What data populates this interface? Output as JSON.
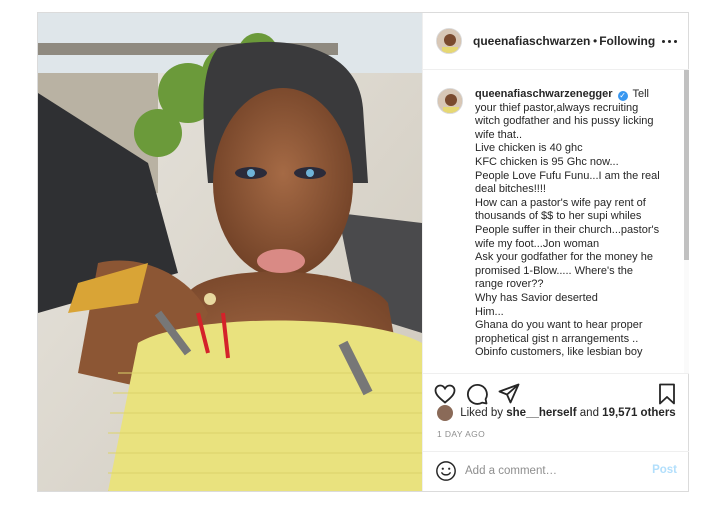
{
  "post": {
    "username": "queenafiaschwarzenegger",
    "username_header": "queenafiaschwarzeneg",
    "follow_status": "Following",
    "caption_lines": [
      "Tell",
      "your thief pastor,always recruiting",
      "witch godfather and his pussy licking",
      "wife that..",
      "Live chicken is 40 ghc",
      "KFC chicken is 95 Ghc now...",
      "People Love Fufu Funu...I am the real",
      "deal bitches!!!!",
      "How can a pastor's wife pay rent of",
      "thousands of $$ to her supi whiles",
      "People suffer in their church...pastor's",
      "wife my foot...Jon woman",
      "Ask your godfather for the money he",
      "promised 1-Blow..... Where's the",
      "range rover??",
      "Why has Savior deserted",
      "Him...",
      "Ghana do you want to hear proper",
      "prophetical gist n arrangements ..",
      "Obinfo customers, like lesbian boy"
    ],
    "likes_prefix": "Liked by",
    "likes_user": "she__herself",
    "likes_and": "and",
    "likes_count": "19,571 others",
    "timestamp": "1 DAY AGO",
    "comment_placeholder": "Add a comment…",
    "post_button": "Post"
  },
  "icons": {
    "more": "more-options-icon",
    "like": "heart-icon",
    "comment": "comment-icon",
    "share": "paper-plane-icon",
    "save": "bookmark-icon",
    "emoji": "smiley-icon",
    "verified": "verified-badge-icon"
  },
  "colors": {
    "verified_blue": "#3897f0",
    "post_button_disabled": "#b2dffc",
    "muted_text": "#8e8e8e",
    "border": "#dbdbdb"
  }
}
